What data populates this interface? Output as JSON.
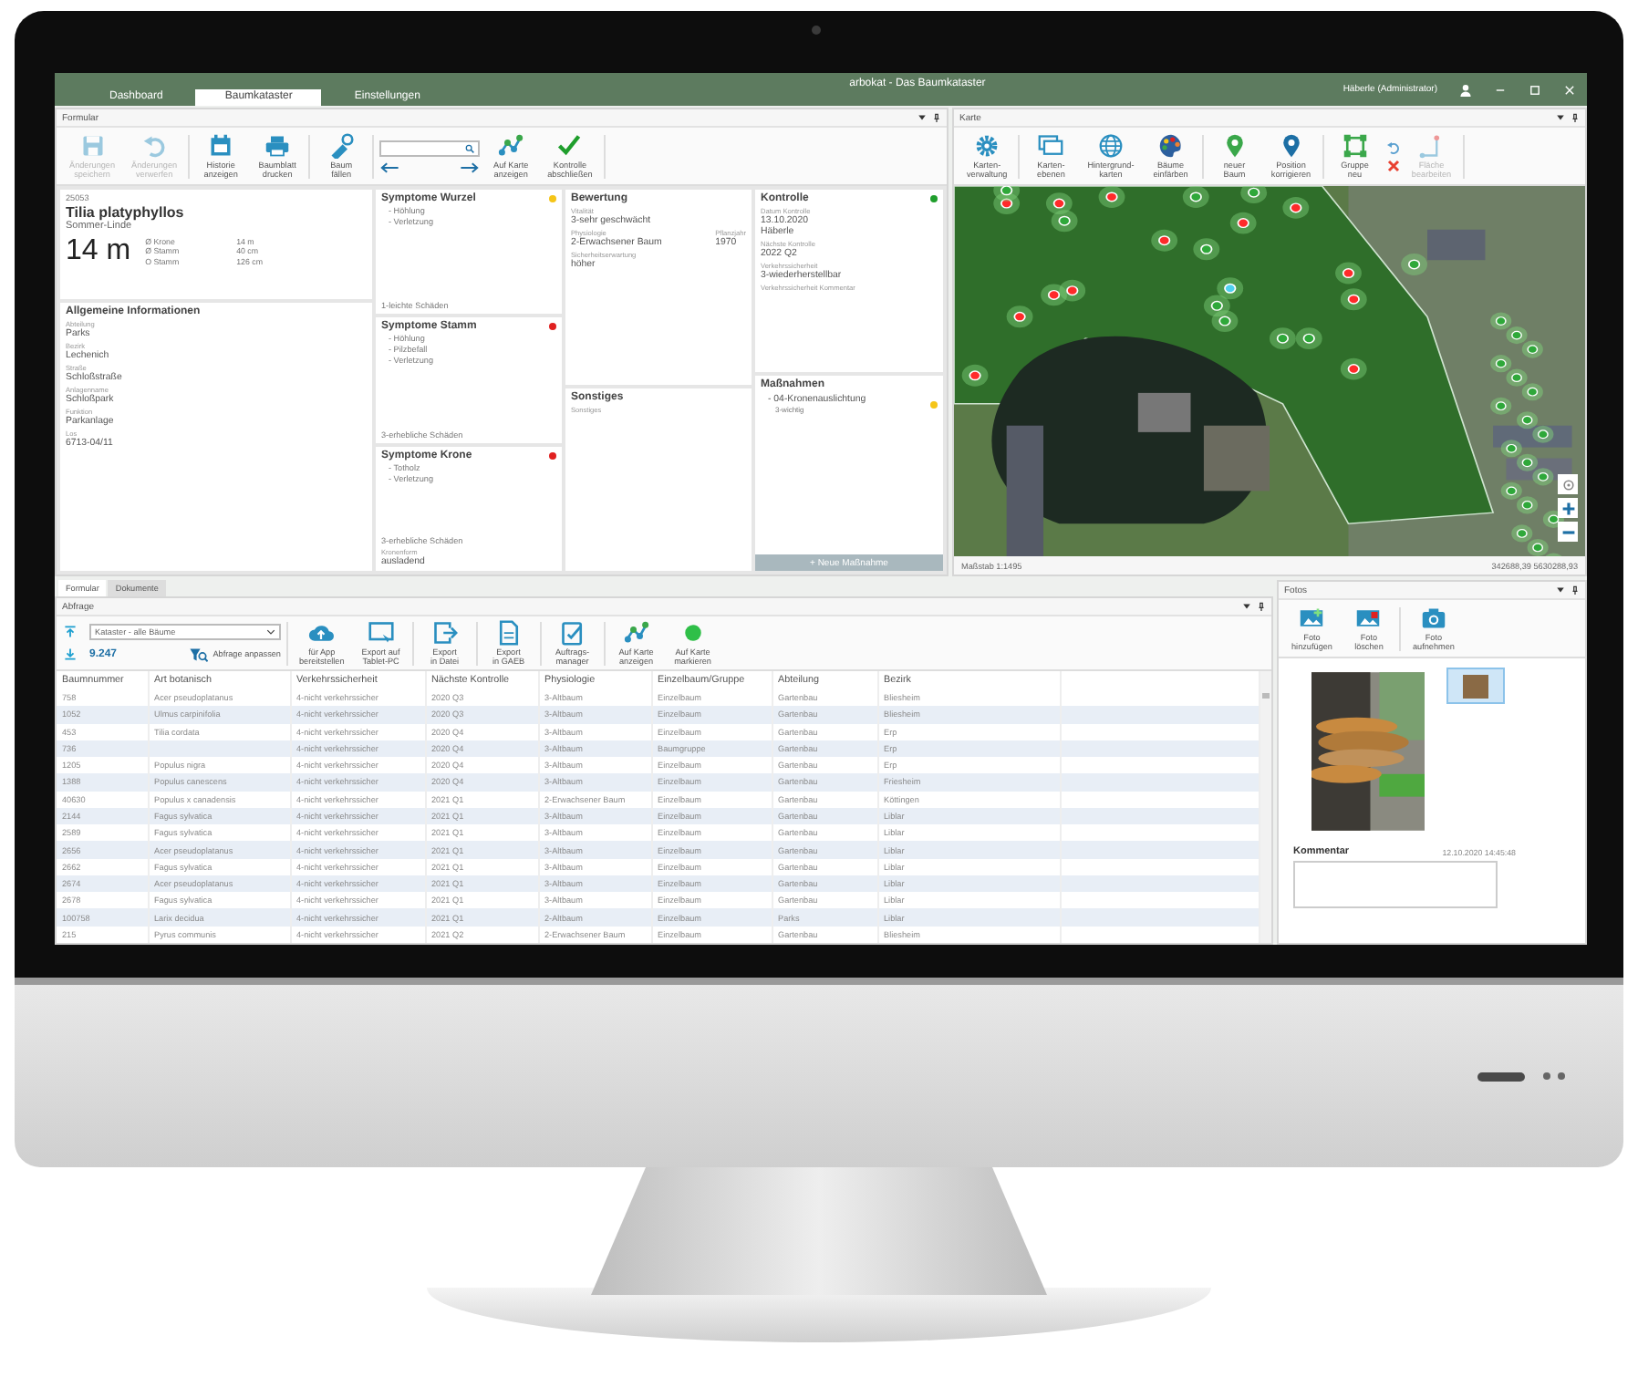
{
  "window": {
    "title": "arbokat - Das Baumkataster",
    "user": "Häberle (Administrator)",
    "tabs": [
      {
        "label": "Dashboard",
        "selected": false
      },
      {
        "label": "Baumkataster",
        "selected": true
      },
      {
        "label": "Einstellungen",
        "selected": false
      }
    ]
  },
  "formular": {
    "title": "Formular",
    "toolbar": [
      {
        "label": "Änderungen\nspeichern",
        "disabled": true
      },
      {
        "label": "Änderungen\nverwerfen",
        "disabled": true
      },
      {
        "label": "Historie\nanzeigen",
        "disabled": false
      },
      {
        "label": "Baumblatt\ndrucken",
        "disabled": false
      },
      {
        "label": "Baum\nfällen",
        "disabled": false
      },
      {
        "label": "Auf Karte\nanzeigen",
        "disabled": false
      },
      {
        "label": "Kontrolle\nabschließen",
        "disabled": false
      }
    ],
    "tree": {
      "number": "25053",
      "botanical": "Tilia platyphyllos",
      "common": "Sommer-Linde",
      "height": "14 m",
      "measures": [
        {
          "label": "Ø Krone",
          "value": "14 m"
        },
        {
          "label": "Ø Stamm",
          "value": "40 cm"
        },
        {
          "label": "O Stamm",
          "value": "126 cm"
        }
      ]
    },
    "general": {
      "title": "Allgemeine Informationen",
      "fields": [
        {
          "label": "Abteilung",
          "value": "Parks"
        },
        {
          "label": "Bezirk",
          "value": "Lechenich"
        },
        {
          "label": "Straße",
          "value": "Schloßstraße"
        },
        {
          "label": "Anlagenname",
          "value": "Schloßpark"
        },
        {
          "label": "Funktion",
          "value": "Parkanlage"
        },
        {
          "label": "Los",
          "value": "6713-04/11"
        }
      ]
    },
    "symptoms": [
      {
        "title": "Symptome Wurzel",
        "color": "#f5c518",
        "items": [
          "- Höhlung",
          "- Verletzung"
        ],
        "rating": "1-leichte Schäden"
      },
      {
        "title": "Symptome Stamm",
        "color": "#e02020",
        "items": [
          "- Höhlung",
          "- Pilzbefall",
          "- Verletzung"
        ],
        "rating": "3-erhebliche Schäden"
      },
      {
        "title": "Symptome Krone",
        "color": "#e02020",
        "items": [
          "- Totholz",
          "- Verletzung"
        ],
        "rating": "3-erhebliche Schäden",
        "extra": {
          "label": "Kronenform",
          "value": "ausladend"
        }
      }
    ],
    "bewertung": {
      "title": "Bewertung",
      "fields": [
        {
          "label": "Vitalität",
          "value": "3-sehr geschwächt"
        },
        {
          "label": "Physiologie",
          "value": "2-Erwachsener Baum",
          "side": {
            "label": "Pflanzjahr",
            "value": "1970"
          }
        },
        {
          "label": "Sicherheitserwartung",
          "value": "höher"
        }
      ]
    },
    "sonstiges": {
      "title": "Sonstiges",
      "label": "Sonstiges"
    },
    "kontrolle": {
      "title": "Kontrolle",
      "color": "#1f9e2c",
      "fields": [
        {
          "label": "Datum Kontrolle",
          "value": "13.10.2020"
        },
        {
          "value": "Häberle"
        },
        {
          "label": "Nächste Kontrolle",
          "value": "2022 Q2"
        },
        {
          "label": "Verkehrssicherheit",
          "value": "3-wiederherstellbar"
        },
        {
          "label": "Verkehrssicherheit Kommentar"
        }
      ]
    },
    "massnahmen": {
      "title": "Maßnahmen",
      "items": [
        {
          "name": "- 04-Kronenauslichtung",
          "note": "3-wichtig",
          "color": "#f5c518"
        }
      ],
      "button": "+ Neue Maßnahme"
    }
  },
  "karte": {
    "title": "Karte",
    "toolbar": [
      {
        "label": "Karten-\nverwaltung",
        "disabled": false
      },
      {
        "label": "Karten-\nebenen",
        "disabled": false
      },
      {
        "label": "Hintergrund-\nkarten",
        "disabled": false
      },
      {
        "label": "Bäume\neinfärben",
        "disabled": false
      },
      {
        "label": "neuer\nBaum",
        "disabled": false
      },
      {
        "label": "Position\nkorrigieren",
        "disabled": false
      },
      {
        "label": "Gruppe\nneu",
        "disabled": false
      },
      {
        "label": "Fläche\nbearbeiten",
        "disabled": true
      }
    ],
    "scale": "Maßstab 1:1495",
    "coords": "342688,39 5630288,93"
  },
  "lower_tabs": [
    {
      "label": "Formular",
      "selected": true
    },
    {
      "label": "Dokumente",
      "selected": false
    }
  ],
  "abfrage": {
    "title": "Abfrage",
    "query": "Kataster - alle Bäume",
    "count": "9.247",
    "adjust": "Abfrage anpassen",
    "toolbar": [
      {
        "label": "für App\nbereitstellen"
      },
      {
        "label": "Export auf\nTablet-PC"
      },
      {
        "label": "Export\nin Datei"
      },
      {
        "label": "Export\nin GAEB"
      },
      {
        "label": "Auftrags-\nmanager"
      },
      {
        "label": "Auf Karte\nanzeigen"
      },
      {
        "label": "Auf Karte\nmarkieren"
      }
    ],
    "table": {
      "columns": [
        "Baumnummer",
        "Art botanisch",
        "Verkehrssicherheit",
        "Nächste Kontrolle",
        "Physiologie",
        "Einzelbaum/Gruppe",
        "Abteilung",
        "Bezirk"
      ],
      "rows": [
        [
          "758",
          "Acer pseudoplatanus",
          "4-nicht verkehrssicher",
          "2020 Q3",
          "3-Altbaum",
          "Einzelbaum",
          "Gartenbau",
          "Bliesheim"
        ],
        [
          "1052",
          "Ulmus carpinifolia",
          "4-nicht verkehrssicher",
          "2020 Q3",
          "3-Altbaum",
          "Einzelbaum",
          "Gartenbau",
          "Bliesheim"
        ],
        [
          "453",
          "Tilia cordata",
          "4-nicht verkehrssicher",
          "2020 Q4",
          "3-Altbaum",
          "Einzelbaum",
          "Gartenbau",
          "Erp"
        ],
        [
          "736",
          null,
          "4-nicht verkehrssicher",
          "2020 Q4",
          "3-Altbaum",
          "Baumgruppe",
          "Gartenbau",
          "Erp"
        ],
        [
          "1205",
          "Populus nigra",
          "4-nicht verkehrssicher",
          "2020 Q4",
          "3-Altbaum",
          "Einzelbaum",
          "Gartenbau",
          "Erp"
        ],
        [
          "1388",
          "Populus canescens",
          "4-nicht verkehrssicher",
          "2020 Q4",
          "3-Altbaum",
          "Einzelbaum",
          "Gartenbau",
          "Friesheim"
        ],
        [
          "40630",
          "Populus x canadensis",
          "4-nicht verkehrssicher",
          "2021 Q1",
          "2-Erwachsener Baum",
          "Einzelbaum",
          "Gartenbau",
          "Köttingen"
        ],
        [
          "2144",
          "Fagus sylvatica",
          "4-nicht verkehrssicher",
          "2021 Q1",
          "3-Altbaum",
          "Einzelbaum",
          "Gartenbau",
          "Liblar"
        ],
        [
          "2589",
          "Fagus sylvatica",
          "4-nicht verkehrssicher",
          "2021 Q1",
          "3-Altbaum",
          "Einzelbaum",
          "Gartenbau",
          "Liblar"
        ],
        [
          "2656",
          "Acer pseudoplatanus",
          "4-nicht verkehrssicher",
          "2021 Q1",
          "3-Altbaum",
          "Einzelbaum",
          "Gartenbau",
          "Liblar"
        ],
        [
          "2662",
          "Fagus sylvatica",
          "4-nicht verkehrssicher",
          "2021 Q1",
          "3-Altbaum",
          "Einzelbaum",
          "Gartenbau",
          "Liblar"
        ],
        [
          "2674",
          "Acer pseudoplatanus",
          "4-nicht verkehrssicher",
          "2021 Q1",
          "3-Altbaum",
          "Einzelbaum",
          "Gartenbau",
          "Liblar"
        ],
        [
          "2678",
          "Fagus sylvatica",
          "4-nicht verkehrssicher",
          "2021 Q1",
          "3-Altbaum",
          "Einzelbaum",
          "Gartenbau",
          "Liblar"
        ],
        [
          "100758",
          "Larix decidua",
          "4-nicht verkehrssicher",
          "2021 Q1",
          "2-Altbaum",
          "Einzelbaum",
          "Parks",
          "Liblar"
        ],
        [
          "215",
          "Pyrus communis",
          "4-nicht verkehrssicher",
          "2021 Q2",
          "2-Erwachsener Baum",
          "Einzelbaum",
          "Gartenbau",
          "Bliesheim"
        ]
      ]
    }
  },
  "fotos": {
    "title": "Fotos",
    "toolbar": [
      {
        "label": "Foto\nhinzufügen"
      },
      {
        "label": "Foto\nlöschen"
      },
      {
        "label": "Foto\naufnehmen"
      }
    ],
    "thumbnails": [
      {
        "selected": true
      }
    ],
    "comment_label": "Kommentar",
    "timestamp": "12.10.2020 14:45:48"
  }
}
